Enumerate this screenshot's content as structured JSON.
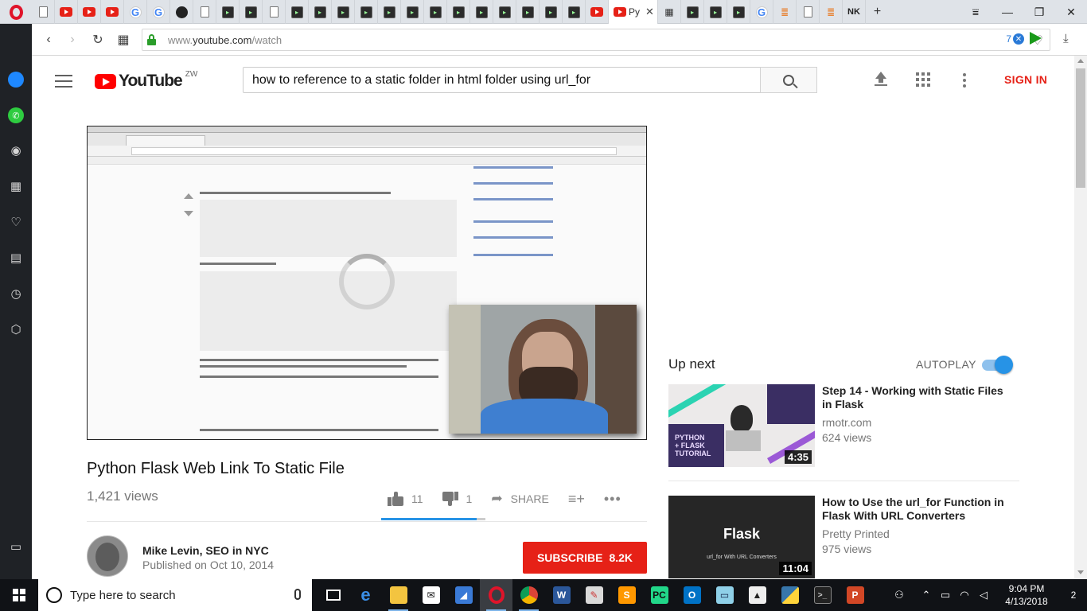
{
  "browser": {
    "active_tab_title": "Py",
    "tab_close": "✕",
    "tab_favicons": [
      "doc",
      "youtube",
      "youtube",
      "youtube",
      "google",
      "google",
      "github",
      "doc",
      "terminal",
      "terminal",
      "doc",
      "terminal",
      "terminal",
      "terminal",
      "terminal",
      "terminal",
      "terminal",
      "terminal",
      "terminal",
      "terminal",
      "terminal",
      "terminal",
      "terminal",
      "terminal",
      "youtube"
    ],
    "tabs_after_active": [
      "grid",
      "terminal",
      "terminal",
      "terminal",
      "google",
      "stackoverflow",
      "doc",
      "stackoverflow"
    ],
    "profile_tab": "NK",
    "new_tab": "+",
    "window_controls": {
      "menu": "⩸",
      "minimize": "—",
      "restore": "❐",
      "close": "✕"
    },
    "nav": {
      "back": "‹",
      "forward": "›",
      "reload": "↻",
      "speed_dial": "▦"
    },
    "url": {
      "prefix": "www.",
      "host": "youtube.com",
      "path": "/watch"
    },
    "ad_block_count": "7",
    "ad_block_x": "✕",
    "heart": "♡",
    "download": "⤓"
  },
  "sidebar": {
    "icons": [
      "messenger-icon",
      "whatsapp-icon",
      "camera-icon",
      "speed-dial-icon",
      "heart-icon",
      "news-icon",
      "history-icon",
      "extensions-icon",
      "sidebar-toggle-icon"
    ],
    "glyphs": {
      "camera": "◉",
      "speed_dial": "▦",
      "heart": "♡",
      "news": "▤",
      "history": "◷",
      "extensions": "⬡",
      "toggle": "▭"
    }
  },
  "youtube": {
    "logo_word": "YouTube",
    "region": "ZW",
    "search_value": "how to reference to a static folder in html folder using url_for",
    "sign_in": "SIGN IN"
  },
  "video": {
    "title": "Python Flask Web Link To Static File",
    "views": "1,421 views",
    "likes": "11",
    "dislikes": "1",
    "like_ratio": 0.917,
    "share": "SHARE",
    "add_to": "≡+",
    "more": "•••",
    "channel": "Mike Levin, SEO in NYC",
    "published": "Published on Oct 10, 2014",
    "subscribe": "SUBSCRIBE",
    "subscribers": "8.2K"
  },
  "up_next": {
    "label": "Up next",
    "autoplay": "AUTOPLAY",
    "autoplay_on": true,
    "items": [
      {
        "title": "Step 14 - Working with Static Files in Flask",
        "channel": "rmotr.com",
        "views": "624 views",
        "duration": "4:35",
        "thumb_text": "PYTHON\n+ FLASK\nTUTORIAL"
      },
      {
        "title": "How to Use the url_for Function in Flask With URL Converters",
        "channel": "Pretty Printed",
        "views": "975 views",
        "duration": "11:04",
        "thumb_text": "Flask",
        "thumb_sub": "url_for With URL Converters"
      }
    ]
  },
  "taskbar": {
    "search_placeholder": "Type here to search",
    "apps": [
      "task-view",
      "edge",
      "file-explorer",
      "mail",
      "photoshop-like",
      "opera",
      "chrome",
      "word",
      "paint",
      "sublime",
      "pycharm",
      "outlook",
      "notepad",
      "photos",
      "python",
      "terminal",
      "powerpoint"
    ],
    "time": "9:04 PM",
    "date": "4/13/2018",
    "notifications": "2"
  }
}
